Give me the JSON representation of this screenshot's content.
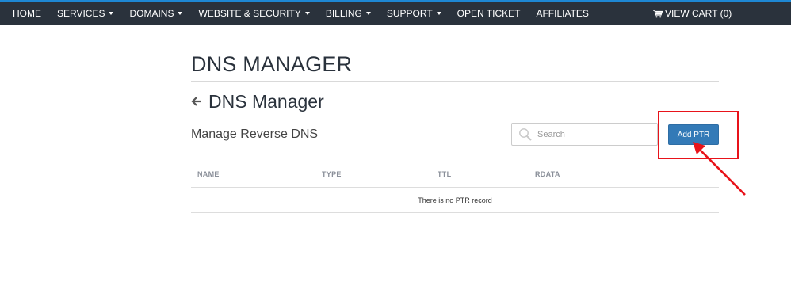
{
  "nav": {
    "items": [
      {
        "label": "HOME",
        "dropdown": false
      },
      {
        "label": "SERVICES",
        "dropdown": true
      },
      {
        "label": "DOMAINS",
        "dropdown": true
      },
      {
        "label": "WEBSITE & SECURITY",
        "dropdown": true
      },
      {
        "label": "BILLING",
        "dropdown": true
      },
      {
        "label": "SUPPORT",
        "dropdown": true
      },
      {
        "label": "OPEN TICKET",
        "dropdown": false
      },
      {
        "label": "AFFILIATES",
        "dropdown": false
      }
    ],
    "cart_label": "VIEW CART (0)",
    "cart_icon": "shopping-cart-icon"
  },
  "page": {
    "title": "DNS MANAGER",
    "subtitle": "DNS Manager",
    "back_icon": "arrow-left-icon"
  },
  "toolbar": {
    "manage_label": "Manage Reverse DNS",
    "search_placeholder": "Search",
    "search_icon": "magnifier-icon",
    "add_button_label": "Add PTR"
  },
  "table": {
    "columns": [
      "NAME",
      "TYPE",
      "TTL",
      "RDATA"
    ],
    "empty_message": "There is no PTR record"
  },
  "colors": {
    "nav_bg": "#2a323c",
    "nav_accent": "#1e88d4",
    "primary_button": "#337ab7",
    "annotation_red": "#e8131a"
  }
}
